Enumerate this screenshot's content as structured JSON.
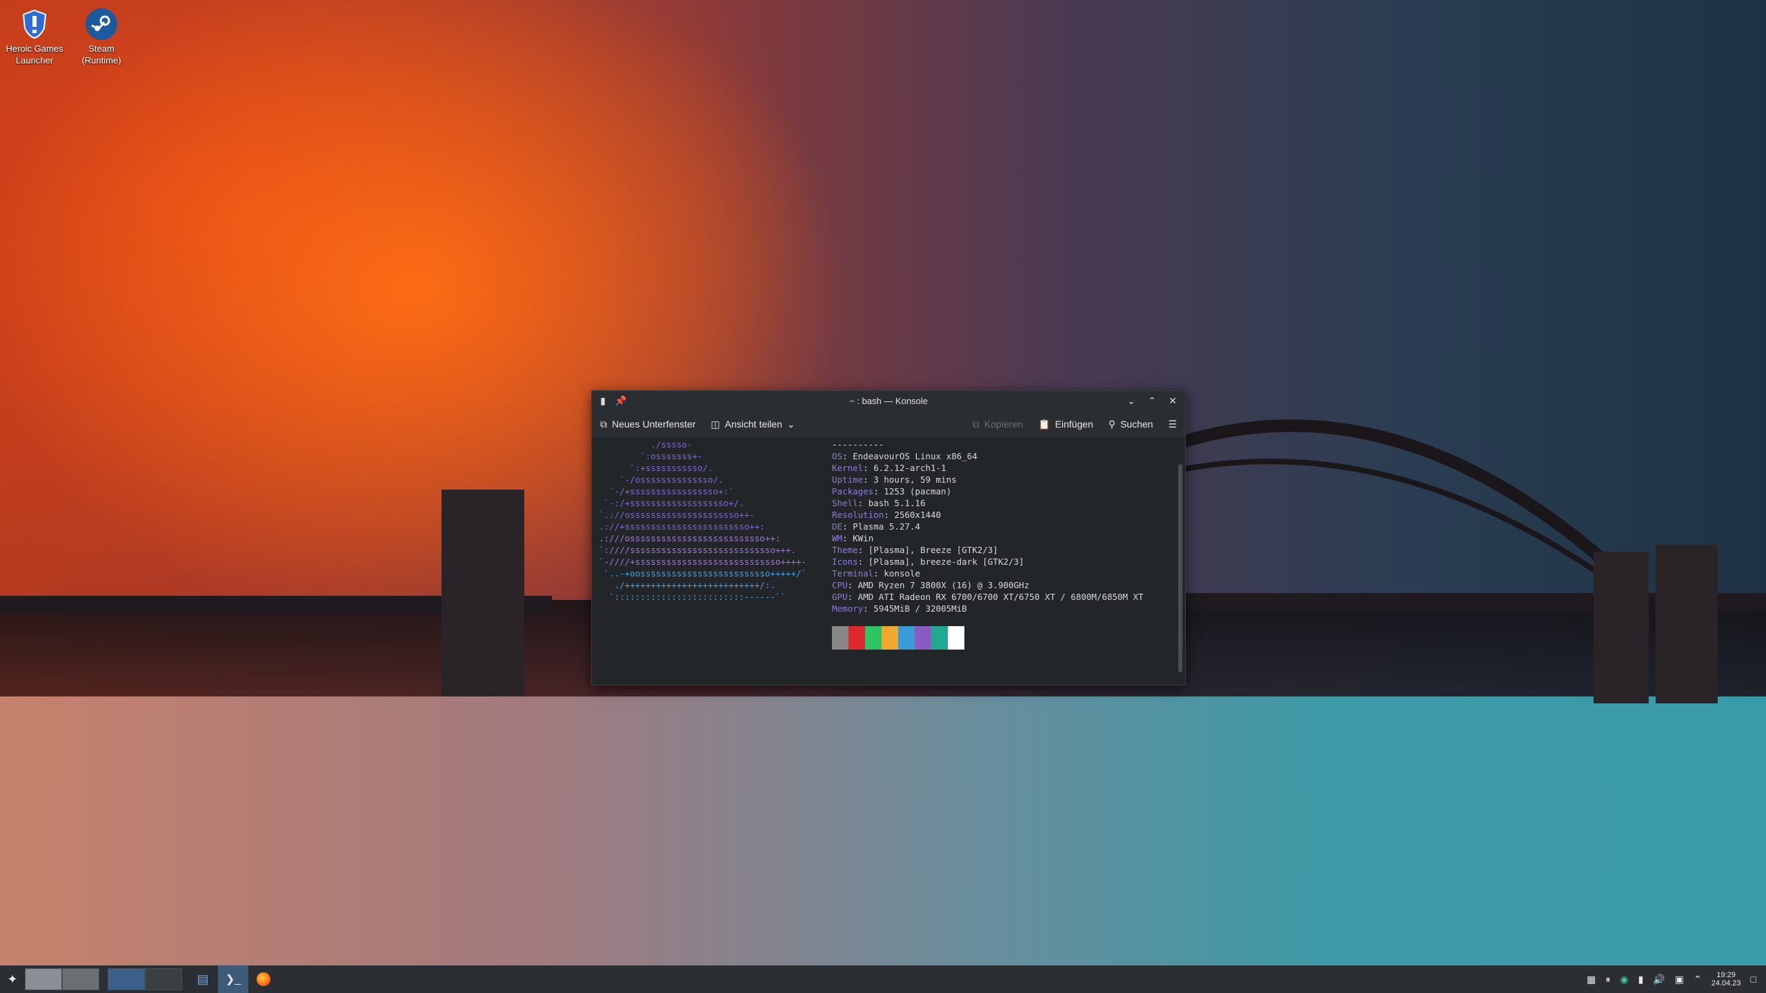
{
  "desktop": {
    "icons": [
      {
        "label_line1": "Heroic Games",
        "label_line2": "Launcher",
        "icon": "heroic-icon"
      },
      {
        "label_line1": "Steam",
        "label_line2": "(Runtime)",
        "icon": "steam-icon"
      }
    ]
  },
  "window": {
    "title": "~ : bash — Konsole",
    "toolbar": {
      "new_tab": "Neues Unterfenster",
      "split_view": "Ansicht teilen",
      "copy": "Kopieren",
      "paste": "Einfügen",
      "search": "Suchen"
    },
    "terminal": {
      "art_lines": [
        "          ./sssso-",
        "        `:osssssss+-",
        "      `:+sssssssssso/.",
        "    `-/ossssssssssssso/.",
        "  `-/+sssssssssssssssso+:`",
        " `-:/+sssssssssssssssssso+/.",
        "`.://osssssssssssssssssssso++-",
        ".://+ssssssssssssssssssssssso++:",
        ".:///ossssssssssssssssssssssssso++:",
        "`:////ssssssssssssssssssssssssssso+++.",
        "`-////+ssssssssssssssssssssssssssso++++-",
        " `..-+oosssssssssssssssssssssssso+++++/`",
        "   ./++++++++++++++++++++++++++/:.",
        "  `:::::::::::::::::::::::::------``"
      ],
      "separator": "----------",
      "info": [
        {
          "key": "OS",
          "value": "EndeavourOS Linux x86_64"
        },
        {
          "key": "Kernel",
          "value": "6.2.12-arch1-1"
        },
        {
          "key": "Uptime",
          "value": "3 hours, 59 mins"
        },
        {
          "key": "Packages",
          "value": "1253 (pacman)"
        },
        {
          "key": "Shell",
          "value": "bash 5.1.16"
        },
        {
          "key": "Resolution",
          "value": "2560x1440"
        },
        {
          "key": "DE",
          "value": "Plasma 5.27.4"
        },
        {
          "key": "WM",
          "value": "KWin"
        },
        {
          "key": "Theme",
          "value": "[Plasma], Breeze [GTK2/3]"
        },
        {
          "key": "Icons",
          "value": "[Plasma], breeze-dark [GTK2/3]"
        },
        {
          "key": "Terminal",
          "value": "konsole"
        },
        {
          "key": "CPU",
          "value": "AMD Ryzen 7 3800X (16) @ 3.900GHz"
        },
        {
          "key": "GPU",
          "value": "AMD ATI Radeon RX 6700/6700 XT/6750 XT / 6800M/6850M XT"
        },
        {
          "key": "Memory",
          "value": "5945MiB / 32005MiB"
        }
      ],
      "colors": [
        "#888888",
        "#e0262e",
        "#2dc463",
        "#f0a830",
        "#3b9bd8",
        "#8b5bc4",
        "#1fa892",
        "#ffffff"
      ]
    }
  },
  "taskbar": {
    "clock_time": "19:29",
    "clock_date": "24.04.23"
  }
}
